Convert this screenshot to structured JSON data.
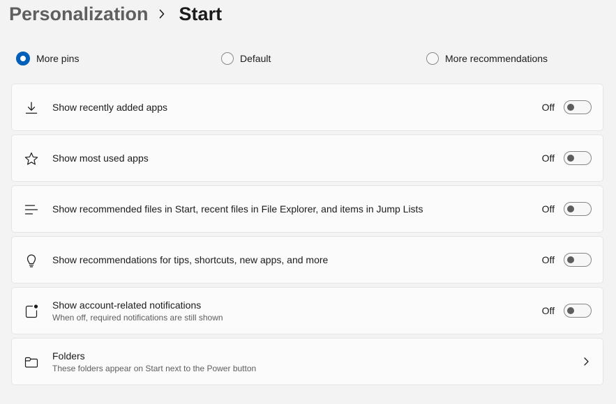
{
  "breadcrumb": {
    "parent": "Personalization",
    "current": "Start"
  },
  "layout_options": [
    {
      "label": "More pins",
      "selected": true
    },
    {
      "label": "Default",
      "selected": false
    },
    {
      "label": "More recommendations",
      "selected": false
    }
  ],
  "settings": [
    {
      "icon": "download-icon",
      "title": "Show recently added apps",
      "state": "Off"
    },
    {
      "icon": "star-icon",
      "title": "Show most used apps",
      "state": "Off"
    },
    {
      "icon": "list-lines-icon",
      "title": "Show recommended files in Start, recent files in File Explorer, and items in Jump Lists",
      "state": "Off"
    },
    {
      "icon": "lightbulb-icon",
      "title": "Show recommendations for tips, shortcuts, new apps, and more",
      "state": "Off"
    },
    {
      "icon": "notification-dot-icon",
      "title": "Show account-related notifications",
      "description": "When off, required notifications are still shown",
      "state": "Off"
    },
    {
      "icon": "folder-icon",
      "title": "Folders",
      "description": "These folders appear on Start next to the Power button"
    }
  ],
  "colors": {
    "accent": "#005fb8",
    "background": "#f3f3f3",
    "card": "#fbfbfb"
  }
}
